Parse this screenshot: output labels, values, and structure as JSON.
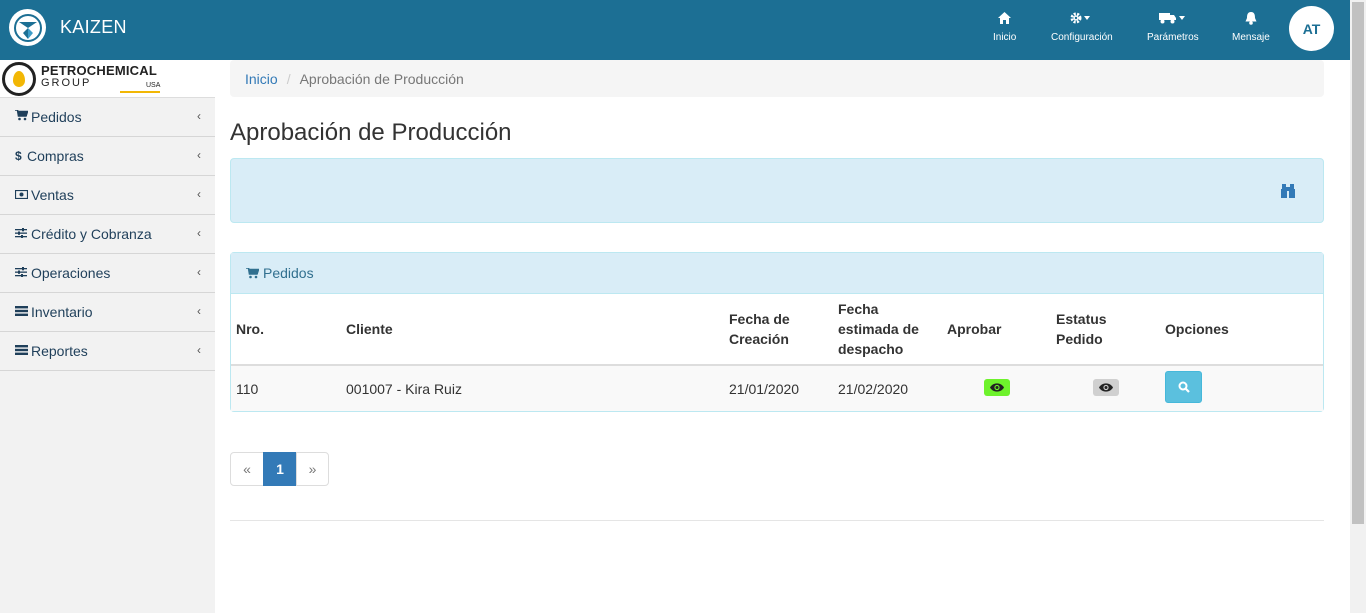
{
  "app": {
    "name": "KAIZEN"
  },
  "nav": {
    "items": [
      {
        "label": "Inicio",
        "icon": "home-icon"
      },
      {
        "label": "Configuración",
        "icon": "gear-icon"
      },
      {
        "label": "Parámetros",
        "icon": "truck-icon"
      },
      {
        "label": "Mensaje",
        "icon": "bell-icon"
      }
    ],
    "avatar": "AT"
  },
  "sidebar": {
    "logo": {
      "line1": "PETROCHEMICAL",
      "line2": "GROUP",
      "line3": "USA"
    },
    "items": [
      {
        "label": "Pedidos",
        "icon": "cart-icon"
      },
      {
        "label": "Compras",
        "icon": "dollar-icon"
      },
      {
        "label": "Ventas",
        "icon": "money-icon"
      },
      {
        "label": "Crédito y Cobranza",
        "icon": "sliders-icon"
      },
      {
        "label": "Operaciones",
        "icon": "sliders-icon"
      },
      {
        "label": "Inventario",
        "icon": "list-icon"
      },
      {
        "label": "Reportes",
        "icon": "list-icon"
      }
    ]
  },
  "breadcrumb": {
    "home": "Inicio",
    "separator": "/",
    "current": "Aprobación de Producción"
  },
  "page": {
    "title": "Aprobación de Producción"
  },
  "orders": {
    "panel_title": "Pedidos",
    "columns": {
      "nro": "Nro.",
      "cliente": "Cliente",
      "fecha_creacion": "Fecha de Creación",
      "fecha_despacho": "Fecha estimada de despacho",
      "aprobar": "Aprobar",
      "estatus": "Estatus Pedido",
      "opciones": "Opciones"
    },
    "rows": [
      {
        "nro": "110",
        "cliente": "001007 - Kira Ruiz",
        "fecha_creacion": "21/01/2020",
        "fecha_despacho": "21/02/2020"
      }
    ]
  },
  "pagination": {
    "prev": "«",
    "current": "1",
    "next": "»"
  },
  "colors": {
    "navbar": "#1c6f94",
    "panel": "#d9edf7",
    "approve": "#6ef22c",
    "primary": "#337ab7",
    "info": "#5bc0de"
  }
}
